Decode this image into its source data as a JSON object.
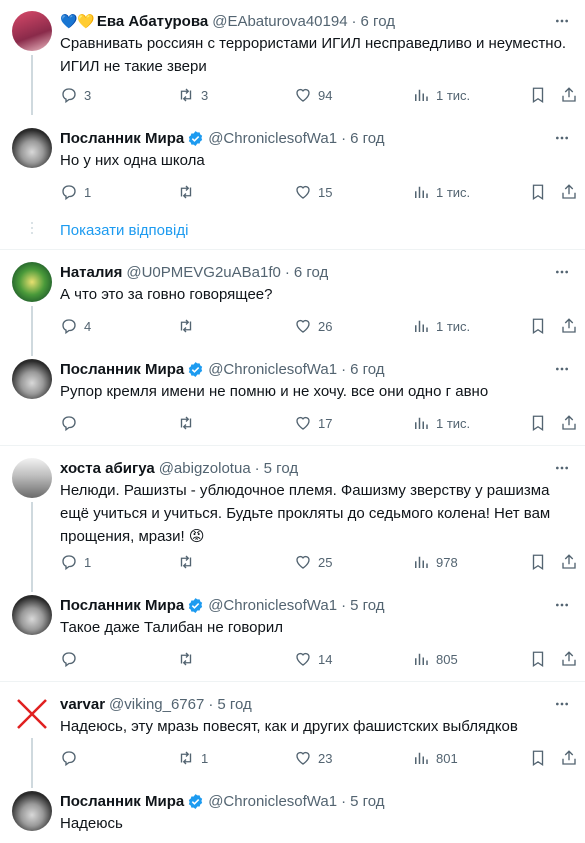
{
  "icons": {
    "reply": "reply-icon",
    "retweet": "retweet-icon",
    "like": "heart-icon",
    "views": "views-icon",
    "bookmark": "bookmark-icon",
    "share": "share-icon",
    "more": "more-icon",
    "verified": "verified-badge-icon"
  },
  "colors": {
    "accent": "#1d9bf0",
    "muted": "#536471",
    "line": "#cfd9de"
  },
  "tweets": [
    {
      "name": "Ева Абатурова",
      "name_prefix_emoji": "💙💛",
      "handle": "@EAbaturova40194",
      "time": "6 год",
      "verified": false,
      "text": "Сравнивать россиян с террористами ИГИЛ несправедливо и неуместно. ИГИЛ не такие звери",
      "replies": "3",
      "retweets": "3",
      "likes": "94",
      "views": "1 тис."
    },
    {
      "name": "Посланник Мира",
      "handle": "@ChroniclesofWa1",
      "time": "6 год",
      "verified": true,
      "text": "Но у них одна школа",
      "replies": "1",
      "retweets": "",
      "likes": "15",
      "views": "1 тис."
    },
    {
      "name": "Наталия",
      "handle": "@U0PMEVG2uABa1f0",
      "time": "6 год",
      "verified": false,
      "text": "А что это за говно говорящее?",
      "replies": "4",
      "retweets": "",
      "likes": "26",
      "views": "1 тис."
    },
    {
      "name": "Посланник Мира",
      "handle": "@ChroniclesofWa1",
      "time": "6 год",
      "verified": true,
      "text": "Рупор кремля имени не помню и не хочу. все они одно г авно",
      "replies": "",
      "retweets": "",
      "likes": "17",
      "views": "1 тис."
    },
    {
      "name": "хоста абигуа",
      "handle": "@abigzolotua",
      "time": "5 год",
      "verified": false,
      "text": "Нелюди. Рашизты - ублюдочное племя. Фашизму зверству у рашизма ещё учиться и учиться. Будьте прокляты до седьмого колена! Нет вам прощения, мрази! 😡",
      "replies": "1",
      "retweets": "",
      "likes": "25",
      "views": "978"
    },
    {
      "name": "Посланник Мира",
      "handle": "@ChroniclesofWa1",
      "time": "5 год",
      "verified": true,
      "text": "Такое даже Талибан не говорил",
      "replies": "",
      "retweets": "",
      "likes": "14",
      "views": "805"
    },
    {
      "name": "varvar",
      "handle": "@viking_6767",
      "time": "5 год",
      "verified": false,
      "text": "Надеюсь, эту мразь повесят, как и других фашистских выблядков",
      "replies": "",
      "retweets": "1",
      "likes": "23",
      "views": "801"
    },
    {
      "name": "Посланник Мира",
      "handle": "@ChroniclesofWa1",
      "time": "5 год",
      "verified": true,
      "text": "Надеюсь"
    }
  ],
  "show_replies_label": "Показати відповіді"
}
